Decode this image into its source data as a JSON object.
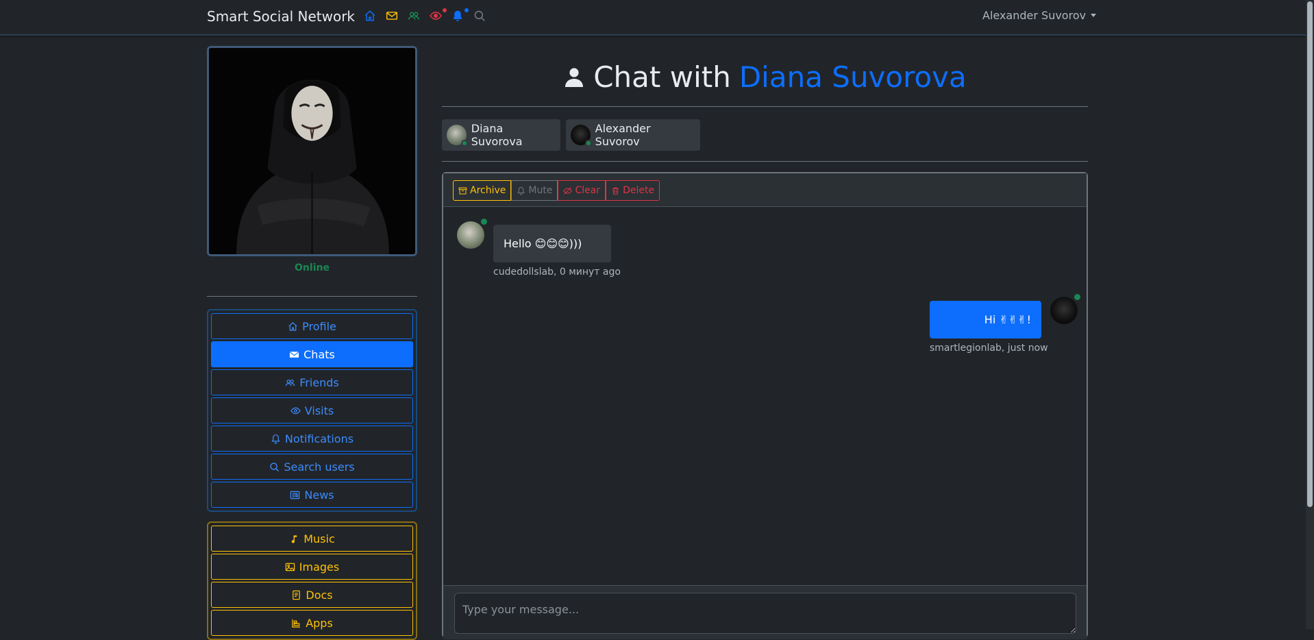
{
  "navbar": {
    "brand": "Smart Social Network",
    "icons": [
      {
        "name": "home-icon",
        "color": "#0d6efd"
      },
      {
        "name": "envelope-icon",
        "color": "#ffc107"
      },
      {
        "name": "people-icon",
        "color": "#198754"
      },
      {
        "name": "eye-icon",
        "color": "#dc3545",
        "dot": "#dc3545"
      },
      {
        "name": "bell-icon",
        "color": "#0d6efd",
        "dot": "#0d6efd"
      },
      {
        "name": "search-icon",
        "color": "#6c757d"
      }
    ],
    "user_name": "Alexander Suvorov"
  },
  "sidebar": {
    "status": "Online",
    "nav": [
      {
        "label": "Profile",
        "icon": "home-icon",
        "active": false
      },
      {
        "label": "Chats",
        "icon": "envelope-icon",
        "active": true
      },
      {
        "label": "Friends",
        "icon": "people-icon",
        "active": false
      },
      {
        "label": "Visits",
        "icon": "eye-icon",
        "active": false
      },
      {
        "label": "Notifications",
        "icon": "bell-icon",
        "active": false
      },
      {
        "label": "Search users",
        "icon": "search-icon",
        "active": false
      },
      {
        "label": "News",
        "icon": "newspaper-icon",
        "active": false
      }
    ],
    "media": [
      {
        "label": "Music",
        "icon": "music-note-icon"
      },
      {
        "label": "Images",
        "icon": "image-icon"
      },
      {
        "label": "Docs",
        "icon": "file-icon"
      },
      {
        "label": "Apps",
        "icon": "apps-icon"
      }
    ]
  },
  "chat": {
    "title_prefix": "Chat with",
    "title_name": "Diana Suvorova",
    "members": [
      {
        "name": "Diana Suvorova",
        "online": true
      },
      {
        "name": "Alexander Suvorov",
        "online": true
      }
    ],
    "toolbar": {
      "archive": "Archive",
      "mute": "Mute",
      "clear": "Clear",
      "delete": "Delete"
    },
    "messages": [
      {
        "direction": "in",
        "text": "Hello 😊😊😊)))",
        "meta": "cudedollslab, 0 минут ago"
      },
      {
        "direction": "out",
        "text": "Hi ✌✌✌!",
        "meta": "smartlegionlab, just now"
      }
    ],
    "input_placeholder": "Type your message..."
  },
  "colors": {
    "primary": "#0d6efd",
    "warning": "#ffc107",
    "success": "#198754",
    "danger": "#dc3545",
    "background": "#212529"
  }
}
